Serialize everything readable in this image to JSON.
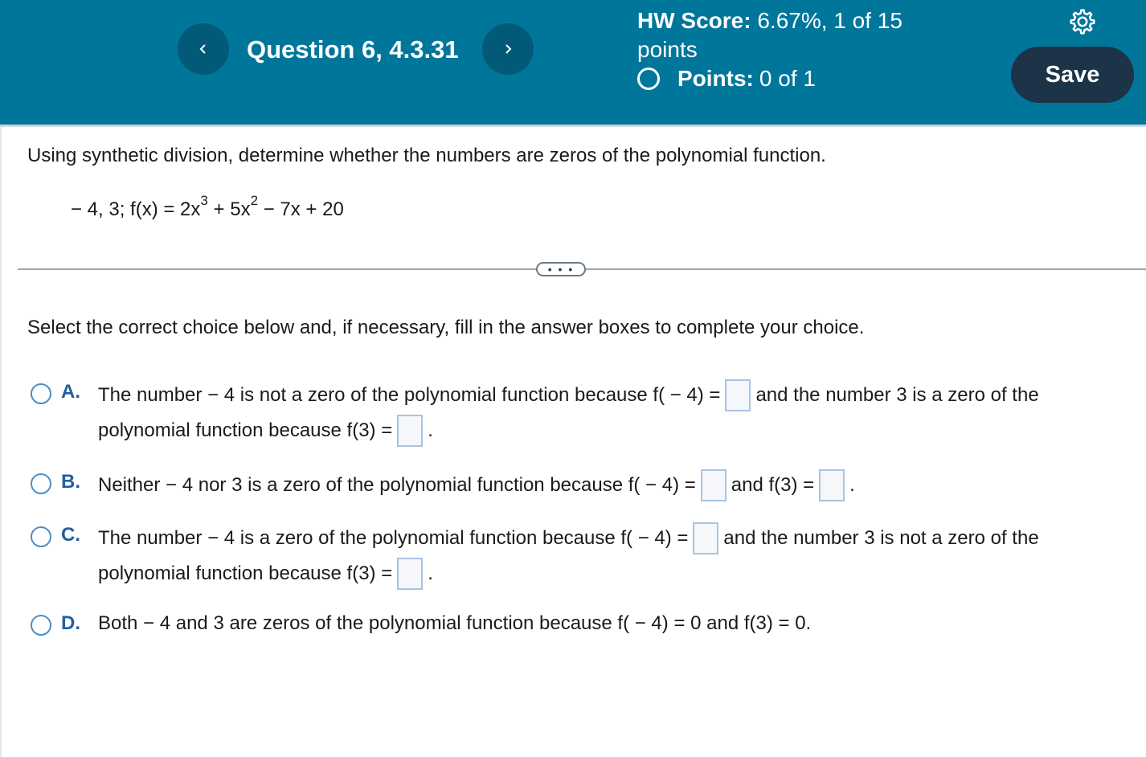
{
  "header": {
    "question_title": "Question 6, 4.3.31",
    "hw_score_label": "HW Score:",
    "hw_score_value": "6.67%, 1 of 15",
    "hw_score_unit": "points",
    "points_label": "Points:",
    "points_value": "0 of 1",
    "save_label": "Save",
    "prev_icon": "chevron-left-icon",
    "next_icon": "chevron-right-icon",
    "settings_icon": "gear-icon"
  },
  "question": {
    "prompt": "Using synthetic division, determine whether the numbers are zeros of the polynomial function.",
    "func_prefix": "− 4, 3; f(x) = 2x",
    "exp1": "3",
    "func_mid": " + 5x",
    "exp2": "2",
    "func_suffix": " − 7x + 20",
    "more_label": "• • •",
    "instruction": "Select the correct choice below and, if necessary, fill in the answer boxes to complete your choice."
  },
  "choices": {
    "a": {
      "letter": "A.",
      "line1_part1": "The number  − 4 is not a zero of the polynomial function because f( − 4) =",
      "line1_part2": "and the number 3 is a zero of the",
      "line2_part1": "polynomial function because f(3) =",
      "line2_part2": "."
    },
    "b": {
      "letter": "B.",
      "part1": "Neither − 4 nor 3 is a zero of the polynomial function because f( − 4) =",
      "part2": "and f(3) =",
      "part3": "."
    },
    "c": {
      "letter": "C.",
      "line1_part1": "The number  − 4 is a zero of the polynomial function because f( − 4) =",
      "line1_part2": "and the number 3 is not a zero of the",
      "line2_part1": "polynomial function because f(3) =",
      "line2_part2": "."
    },
    "d": {
      "letter": "D.",
      "text": "Both  − 4 and 3 are zeros of the polynomial function because f( − 4) = 0 and f(3) = 0."
    }
  }
}
